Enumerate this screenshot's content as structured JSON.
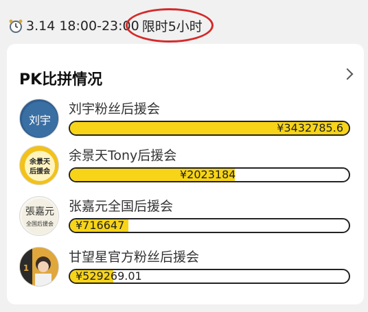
{
  "event": {
    "time": "3.14 18:00-23:00",
    "limit": "限时5小时"
  },
  "panel": {
    "title": "PK比拼情况"
  },
  "colors": {
    "accent_fill": "#f7d417",
    "highlight_ring": "#d42a2a"
  },
  "entries": [
    {
      "name": "刘宇粉丝后援会",
      "amount": "¥3432785.6",
      "progress": 1.0,
      "avatar_text": "刘宇",
      "avatar_icon": "blue-calligraphy-avatar-icon"
    },
    {
      "name": "余景天Tony后援会",
      "amount": "¥2023184",
      "progress": 0.59,
      "avatar_text": "余景天后援会",
      "avatar_icon": "yellow-badge-avatar-icon"
    },
    {
      "name": "张嘉元全国后援会",
      "amount": "¥716647",
      "progress": 0.21,
      "avatar_text": "全国后援会",
      "avatar_icon": "calligraphy-avatar-icon"
    },
    {
      "name": "甘望星官方粉丝后援会",
      "amount": "¥529269.01",
      "progress": 0.155,
      "avatar_text": "",
      "avatar_icon": "photo-avatar-icon"
    }
  ]
}
